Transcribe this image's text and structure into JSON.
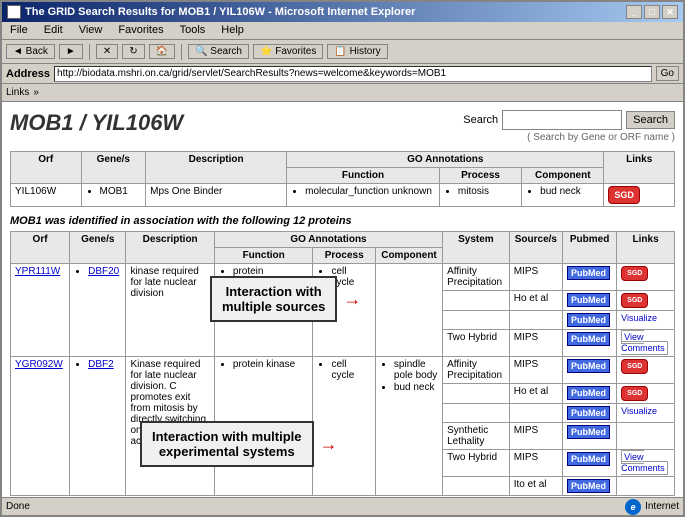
{
  "window": {
    "title": "The GRID Search Results for MOB1 / YIL106W - Microsoft Internet Explorer",
    "icon": "IE"
  },
  "menu": {
    "items": [
      "File",
      "Edit",
      "View",
      "Favorites",
      "Tools",
      "Help"
    ]
  },
  "toolbar": {
    "back_label": "◄ Back",
    "forward_label": "►",
    "stop_label": "✕",
    "refresh_label": "↻",
    "home_label": "🏠",
    "search_label": "🔍 Search",
    "favorites_label": "⭐ Favorites",
    "history_label": "📋 History"
  },
  "address": {
    "label": "Address",
    "url": "http://biodata.mshri.on.ca/grid/servlet/SearchResults?news=welcome&keywords=MOB1",
    "go_label": "Go"
  },
  "links_bar": {
    "label": "Links",
    "items": []
  },
  "page": {
    "title": "MOB1 / YIL106W",
    "search_label": "Search",
    "search_hint": "( Search by Gene or ORF name )",
    "search_placeholder": "",
    "search_button": "Search"
  },
  "top_table": {
    "headers": {
      "orf": "Orf",
      "gene": "Gene/s",
      "description": "Description",
      "go_annotations": "GO Annotations",
      "function": "Function",
      "process": "Process",
      "component": "Component",
      "links": "Links"
    },
    "row": {
      "orf": "YIL106W",
      "gene": "MOB1",
      "description": "Mps One Binder",
      "function": "molecular_function unknown",
      "process": "mitosis",
      "component": "bud neck",
      "links": "SGD"
    }
  },
  "association_text": "MOB1 was identified in association with the following 12 proteins",
  "bottom_table": {
    "headers": {
      "orf": "Orf",
      "gene": "Gene/s",
      "description": "Description",
      "go_annotations": "GO Annotations",
      "function": "Function",
      "process": "Process",
      "component": "Component",
      "system": "System",
      "source": "Source/s",
      "pubmed": "Pubmed",
      "links": "Links"
    },
    "rows": [
      {
        "orf": "YPR111W",
        "gene": "DBF20",
        "description": "kinase required for late nuclear division",
        "function_items": [
          "protein serine/threonine kinase"
        ],
        "process_items": [
          "cell cycle"
        ],
        "component_items": [],
        "entries": [
          {
            "system": "Affinity Precipitation",
            "source": "MIPS",
            "pubmed": "PubMed",
            "links": "SGD"
          },
          {
            "system": "",
            "source": "Ho et al",
            "pubmed": "PubMed",
            "links": "SGD"
          },
          {
            "system": "",
            "source": "",
            "pubmed": "PubMed",
            "links": "Visualize"
          },
          {
            "system": "Two Hybrid",
            "source": "MIPS",
            "pubmed": "PubMed",
            "links": "View Comments"
          }
        ]
      },
      {
        "orf": "YGR092W",
        "gene": "DBF2",
        "description": "Kinase required for late nuclear division. C promotes exit from mitosis by directly switching on the kinase activity of Dbf2.",
        "function_items": [
          "protein kinase"
        ],
        "process_items": [
          "cell cycle"
        ],
        "component_items": [
          "spindle pole body",
          "bud neck"
        ],
        "entries": [
          {
            "system": "Affinity Precipitation",
            "source": "MIPS",
            "pubmed": "PubMed",
            "links": "SGD"
          },
          {
            "system": "",
            "source": "Ho et al",
            "pubmed": "PubMed",
            "links": "SGD"
          },
          {
            "system": "",
            "source": "",
            "pubmed": "PubMed",
            "links": "Visualize"
          },
          {
            "system": "Synthetic Lethality",
            "source": "MIPS",
            "pubmed": "PubMed",
            "links": ""
          },
          {
            "system": "Two Hybrid",
            "source": "MIPS",
            "pubmed": "PubMed",
            "links": "View Comments"
          },
          {
            "system": "",
            "source": "Ito et al",
            "pubmed": "PubMed",
            "links": ""
          }
        ]
      }
    ]
  },
  "callouts": {
    "multiple_sources": "Interaction with\nmultiple sources",
    "multiple_systems": "Interaction with multiple\nexperimental systems"
  },
  "status": {
    "left": "Done",
    "right": "Internet"
  }
}
